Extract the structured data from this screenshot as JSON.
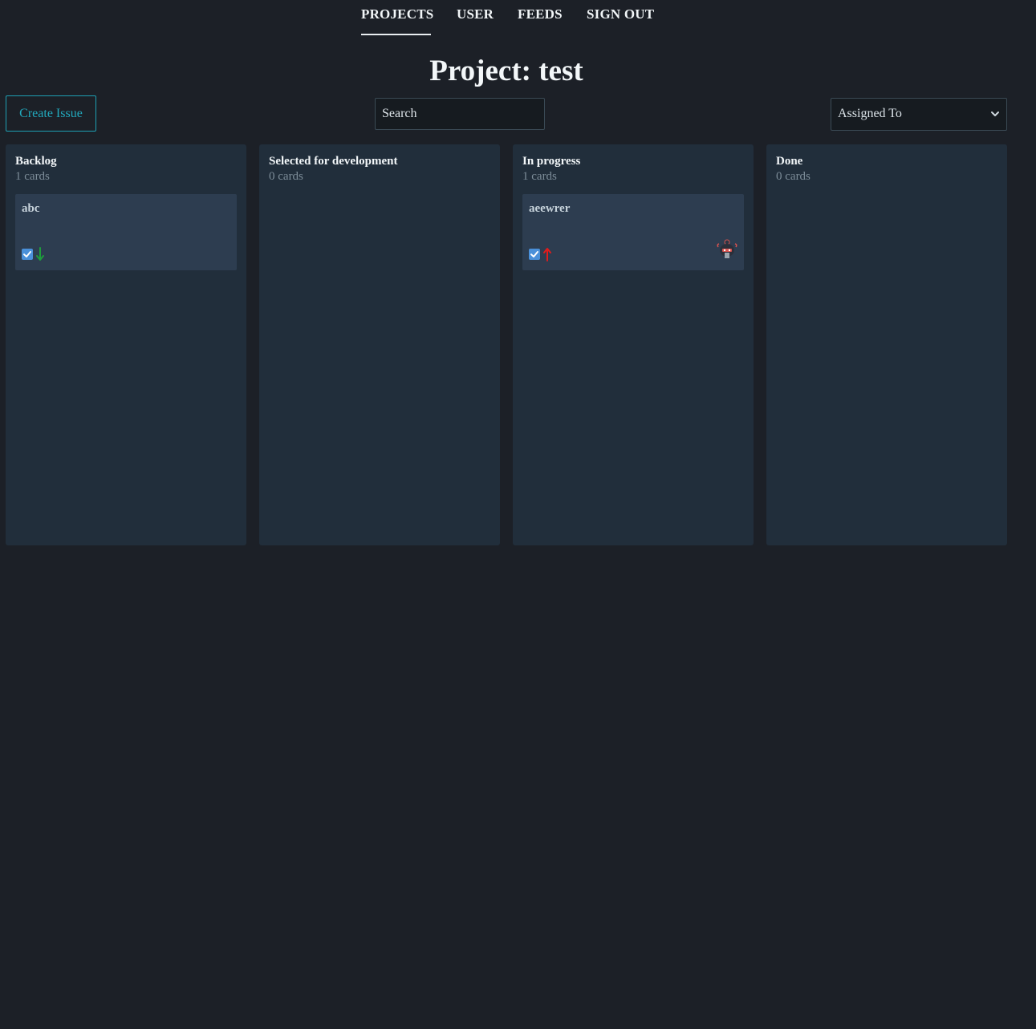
{
  "nav": {
    "items": [
      {
        "label": "PROJECTS",
        "active": true
      },
      {
        "label": "USER",
        "active": false
      },
      {
        "label": "FEEDS",
        "active": false
      },
      {
        "label": "SIGN OUT",
        "active": false
      }
    ]
  },
  "page": {
    "title": "Project: test"
  },
  "toolbar": {
    "create_label": "Create Issue",
    "search_placeholder": "Search",
    "search_value": "",
    "assigned_select_value": "Assigned To"
  },
  "columns": [
    {
      "title": "Backlog",
      "count_label": "1 cards",
      "cards": [
        {
          "title": "abc",
          "type_icon": "task-checkbox-icon",
          "priority_icon": "arrow-down-icon",
          "priority_color": "#1e9e3c",
          "has_avatar": false
        }
      ]
    },
    {
      "title": "Selected for development",
      "count_label": "0 cards",
      "cards": []
    },
    {
      "title": "In progress",
      "count_label": "1 cards",
      "cards": [
        {
          "title": "aeewrer",
          "type_icon": "task-checkbox-icon",
          "priority_icon": "arrow-up-icon",
          "priority_color": "#e21b1b",
          "has_avatar": true
        }
      ]
    },
    {
      "title": "Done",
      "count_label": "0 cards",
      "cards": []
    }
  ],
  "colors": {
    "background": "#1c2027",
    "column_bg": "#212e3b",
    "card_bg": "#2d3d50",
    "accent": "#22a9bd",
    "task_icon": "#4a90d9"
  }
}
